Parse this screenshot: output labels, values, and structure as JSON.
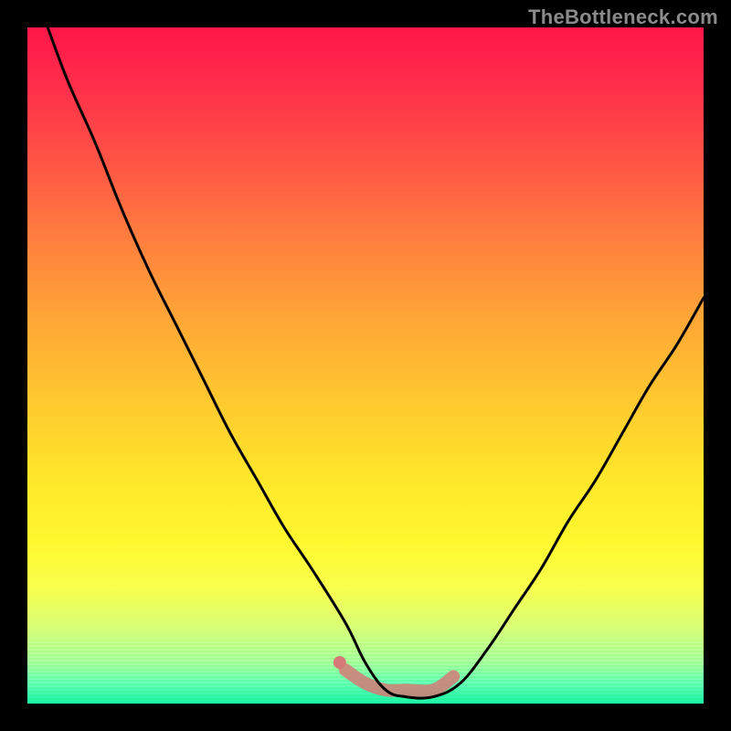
{
  "watermark": "TheBottleneck.com",
  "colors": {
    "page_bg": "#000000",
    "watermark": "#8b8b8b",
    "curve_stroke": "#000000",
    "fuzzy_stroke": "#d57a77"
  },
  "chart_data": {
    "type": "line",
    "title": "",
    "xlabel": "",
    "ylabel": "",
    "xlim": [
      0,
      100
    ],
    "ylim": [
      0,
      100
    ],
    "grid": false,
    "legend": false,
    "series": [
      {
        "name": "bottleneck-curve",
        "x": [
          3,
          6,
          10,
          14,
          18,
          22,
          26,
          30,
          34,
          38,
          42,
          47,
          50,
          53,
          56,
          60,
          64,
          68,
          72,
          76,
          80,
          84,
          88,
          92,
          96,
          100
        ],
        "y": [
          100,
          92,
          83,
          73,
          64,
          56,
          48,
          40,
          33,
          26,
          20,
          12,
          6,
          2,
          1,
          1,
          3,
          8,
          14,
          20,
          27,
          33,
          40,
          47,
          53,
          60
        ]
      },
      {
        "name": "fuzzy-bottom-segment",
        "x": [
          47,
          50,
          53,
          56,
          60,
          63
        ],
        "y": [
          5,
          3,
          2,
          2,
          2,
          4
        ]
      }
    ]
  }
}
